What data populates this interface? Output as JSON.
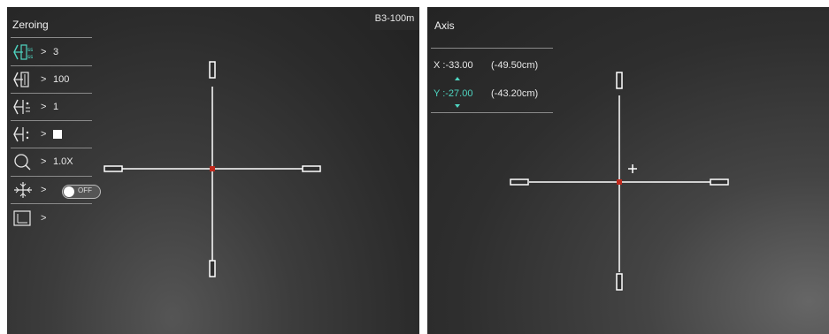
{
  "left_panel": {
    "menu_title": "Zeroing",
    "range_badge": "B3-100m",
    "items": [
      {
        "icon": "zeroing-clicks-icon",
        "arrow": ">",
        "value": "3",
        "active": true
      },
      {
        "icon": "zeroing-distance-icon",
        "arrow": ">",
        "value": "100",
        "active": false
      },
      {
        "icon": "zeroing-profile-icon",
        "arrow": ">",
        "value": "1",
        "active": false
      },
      {
        "icon": "reticle-style-icon",
        "arrow": ">",
        "value": "",
        "active": false
      },
      {
        "icon": "zoom-icon",
        "arrow": ">",
        "value": "1.0X",
        "active": false
      },
      {
        "icon": "freeze-icon",
        "arrow": ">",
        "value": "OFF",
        "active": false
      },
      {
        "icon": "axis-adjust-icon",
        "arrow": ">",
        "value": "",
        "active": false
      }
    ]
  },
  "right_panel": {
    "menu_title": "Axis",
    "x_label": "X :-33.00",
    "x_cm": "(-49.50cm)",
    "y_label": "Y :-27.00",
    "y_cm": "(-43.20cm)"
  },
  "colors": {
    "accent": "#4fd6c2",
    "reticle": "#ffffff",
    "center_dot": "#c0281c"
  },
  "icons": [
    "zeroing-clicks-icon",
    "zeroing-distance-icon",
    "zeroing-profile-icon",
    "reticle-style-icon",
    "zoom-icon",
    "freeze-icon",
    "axis-adjust-icon",
    "up-arrow-icon",
    "down-arrow-icon",
    "plus-icon"
  ]
}
